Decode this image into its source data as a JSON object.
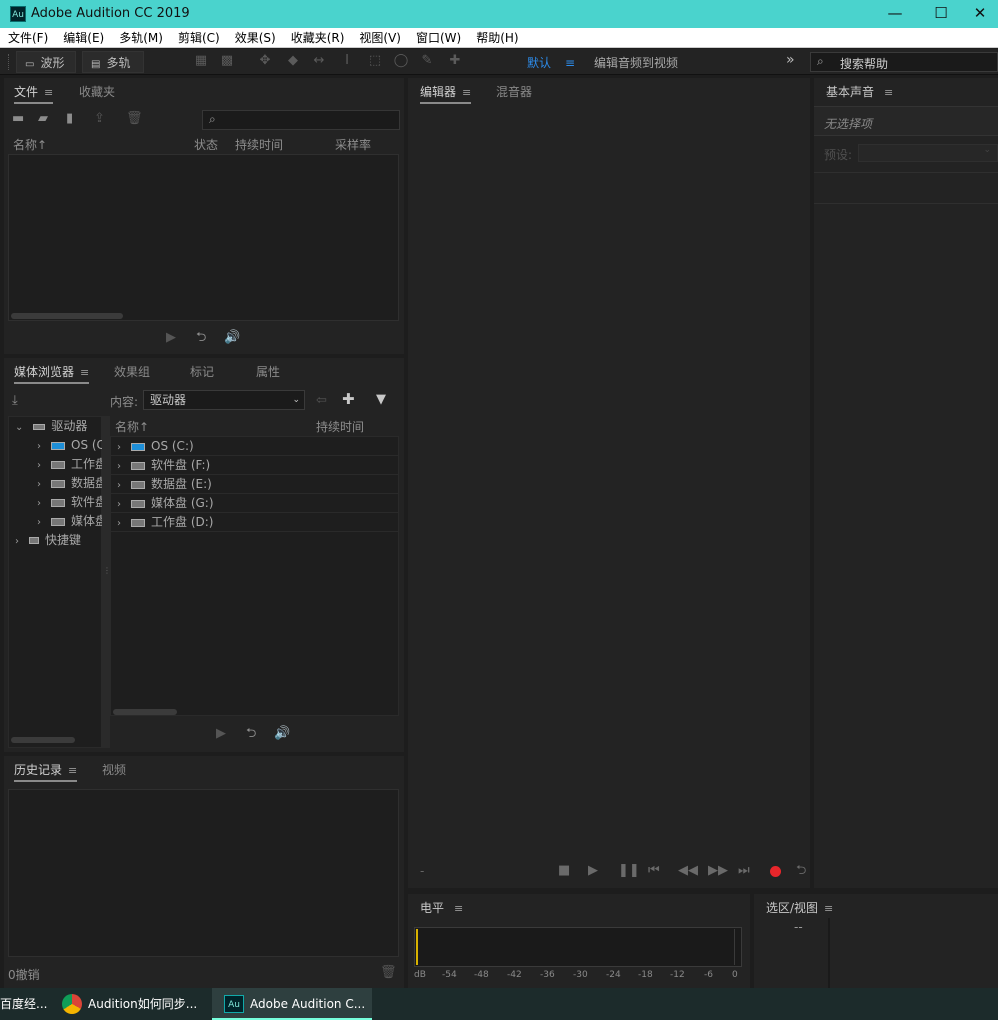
{
  "app": {
    "title": "Adobe Audition CC 2019",
    "logo": "Au"
  },
  "window_controls": {
    "minimize": "—",
    "maximize": "☐",
    "close": "✕"
  },
  "menu": [
    "文件(F)",
    "编辑(E)",
    "多轨(M)",
    "剪辑(C)",
    "效果(S)",
    "收藏夹(R)",
    "视图(V)",
    "窗口(W)",
    "帮助(H)"
  ],
  "toolbar": {
    "waveform": "波形",
    "multitrack": "多轨",
    "workspace_default": "默认",
    "workspace_video": "编辑音频到视频",
    "overflow": "»",
    "search_placeholder": "搜索帮助"
  },
  "files_panel": {
    "tabs": [
      "文件",
      "收藏夹"
    ],
    "columns": [
      "名称↑",
      "状态",
      "持续时间",
      "采样率"
    ]
  },
  "media_panel": {
    "tabs": [
      "媒体浏览器",
      "效果组",
      "标记",
      "属性"
    ],
    "content_label": "内容:",
    "content_value": "驱动器",
    "columns": [
      "名称↑",
      "持续时间"
    ],
    "tree": [
      {
        "label": "驱动器",
        "expanded": true
      },
      {
        "label": "OS (C:)"
      },
      {
        "label": "工作盘 (D:)"
      },
      {
        "label": "数据盘 (E:)"
      },
      {
        "label": "软件盘 (F:)"
      },
      {
        "label": "媒体盘 (G:)"
      },
      {
        "label": "快捷键"
      }
    ],
    "rows": [
      "OS (C:)",
      "软件盘 (F:)",
      "数据盘 (E:)",
      "媒体盘 (G:)",
      "工作盘 (D:)"
    ]
  },
  "history_panel": {
    "tabs": [
      "历史记录",
      "视频"
    ],
    "undo": "0撤销"
  },
  "editor_panel": {
    "tabs": [
      "编辑器",
      "混音器"
    ],
    "dash": "-"
  },
  "essential_sound": {
    "title": "基本声音",
    "no_selection": "无选择项",
    "preset_label": "预设:"
  },
  "level_panel": {
    "title": "电平",
    "scale": [
      "dB",
      "-54",
      "-48",
      "-42",
      "-36",
      "-30",
      "-24",
      "-18",
      "-12",
      "-6",
      "0"
    ]
  },
  "selection_panel": {
    "title": "选区/视图",
    "dash": "--"
  },
  "taskbar": {
    "items": [
      "百度经...",
      "Audition如何同步...",
      "Adobe Audition C..."
    ]
  },
  "colors": {
    "accent": "#4ad3cd",
    "workspace_active": "#2d8ceb",
    "record": "#e8262b"
  }
}
